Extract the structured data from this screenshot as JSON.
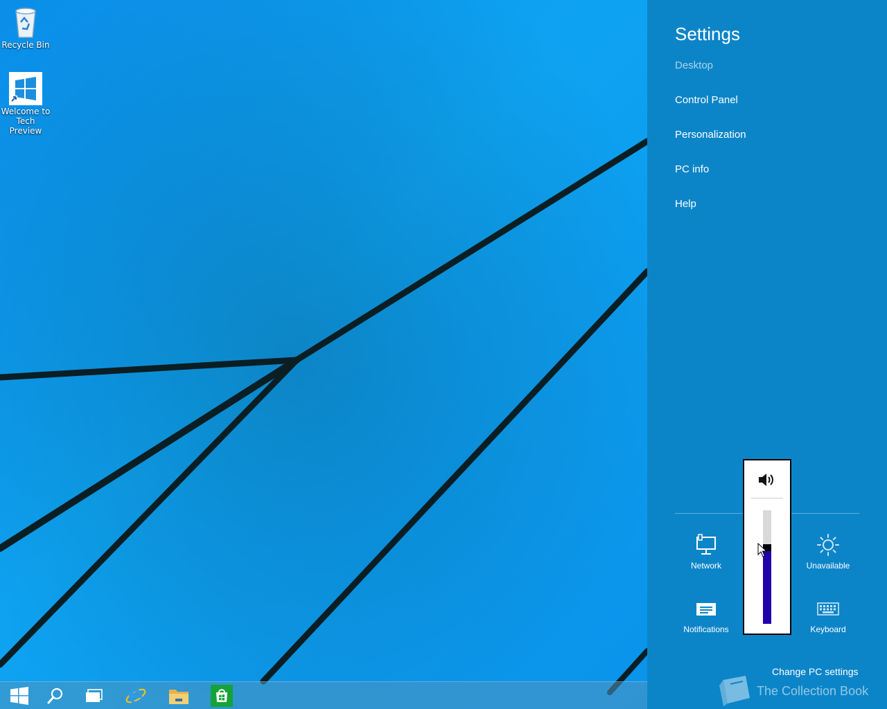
{
  "desktop": {
    "icons": [
      {
        "label": "Recycle Bin",
        "icon": "recycle-bin-icon"
      },
      {
        "label": "Welcome to Tech Preview",
        "icon": "windows-logo-icon"
      }
    ]
  },
  "taskbar": {
    "buttons": [
      {
        "icon": "start-icon"
      },
      {
        "icon": "search-icon"
      },
      {
        "icon": "task-view-icon"
      },
      {
        "icon": "internet-explorer-icon"
      },
      {
        "icon": "file-explorer-icon"
      },
      {
        "icon": "store-icon"
      }
    ]
  },
  "charm": {
    "title": "Settings",
    "context": "Desktop",
    "links": [
      "Control Panel",
      "Personalization",
      "PC info",
      "Help"
    ],
    "tiles": {
      "network": "Network",
      "unavailable": "Unavailable",
      "notifications": "Notifications",
      "keyboard": "Keyboard"
    },
    "change_pc_settings": "Change PC settings",
    "watermark": "The Collection Book",
    "colors": {
      "background": "#0c85c8",
      "context_text": "#a9d4ef"
    }
  },
  "volume": {
    "icon": "speaker-icon",
    "level_percent": 67,
    "fill_color": "#2200aa"
  }
}
